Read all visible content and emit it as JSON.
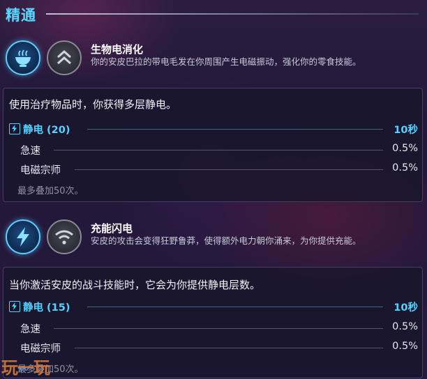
{
  "section": {
    "title": "精通"
  },
  "skills": [
    {
      "name": "生物电消化",
      "description": "你的安皮巴拉的带电毛发在你周围产生电磁振动，强化你的零食技能。",
      "active_icon": "bowl-icon",
      "inactive_icon": "double-chevron-up-icon",
      "summary": "使用治疗物品时，你获得多层静电。",
      "main_stat": {
        "label": "静电 (20)",
        "value": "10秒"
      },
      "sub_stats": [
        {
          "label": "急速",
          "value": "0.5%"
        },
        {
          "label": "电磁宗师",
          "value": "0.5%"
        }
      ],
      "stack_note": "最多叠加50次。"
    },
    {
      "name": "充能闪电",
      "description": "安皮的攻击会变得狂野鲁莽，使得额外电力朝你涌来，为你提供充能。",
      "active_icon": "lightning-bolt-icon",
      "inactive_icon": "wifi-signal-icon",
      "summary": "当你激活安皮的战斗技能时，它会为你提供静电层数。",
      "main_stat": {
        "label": "静电 (15)",
        "value": "10秒"
      },
      "sub_stats": [
        {
          "label": "急速",
          "value": "0.5%"
        },
        {
          "label": "电磁宗师",
          "value": "0.5%"
        }
      ],
      "stack_note": "最多叠加50次。"
    }
  ],
  "watermark": {
    "text": "玩一玩",
    "icon": "wave-icon"
  },
  "colors": {
    "accent": "#52d3ff",
    "panel_bg": "#18162c",
    "muted": "#8f92a6"
  }
}
